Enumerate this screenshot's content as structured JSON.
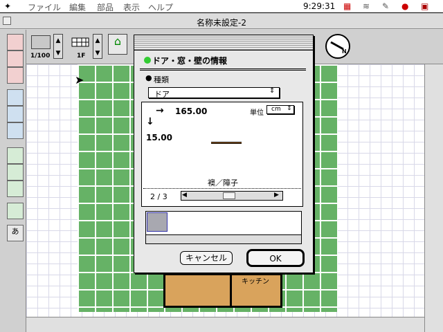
{
  "menubar": {
    "items": [
      "ファイル",
      "編集",
      "部品",
      "表示",
      "ヘルプ"
    ],
    "clock": "9:29:31"
  },
  "window": {
    "title": "名称未設定-2"
  },
  "toolbar": {
    "scale": "1/100",
    "floor": "1F"
  },
  "dialog": {
    "title": "ドア・窓・壁の情報",
    "kind_label": "種類",
    "kind_value": "ドア",
    "width_value": "165.00",
    "depth_value": "15.00",
    "unit_label": "単位",
    "unit_value": "cm",
    "item_name": "襖／障子",
    "page_indicator": "2 / 3",
    "cancel_label": "キャンセル",
    "ok_label": "OK"
  },
  "floorplan": {
    "room_label": "キッチン"
  },
  "colors": {
    "accent_green": "#66b266",
    "dialog_bg": "#e8e8e8",
    "room_fill": "#d9a35c"
  }
}
